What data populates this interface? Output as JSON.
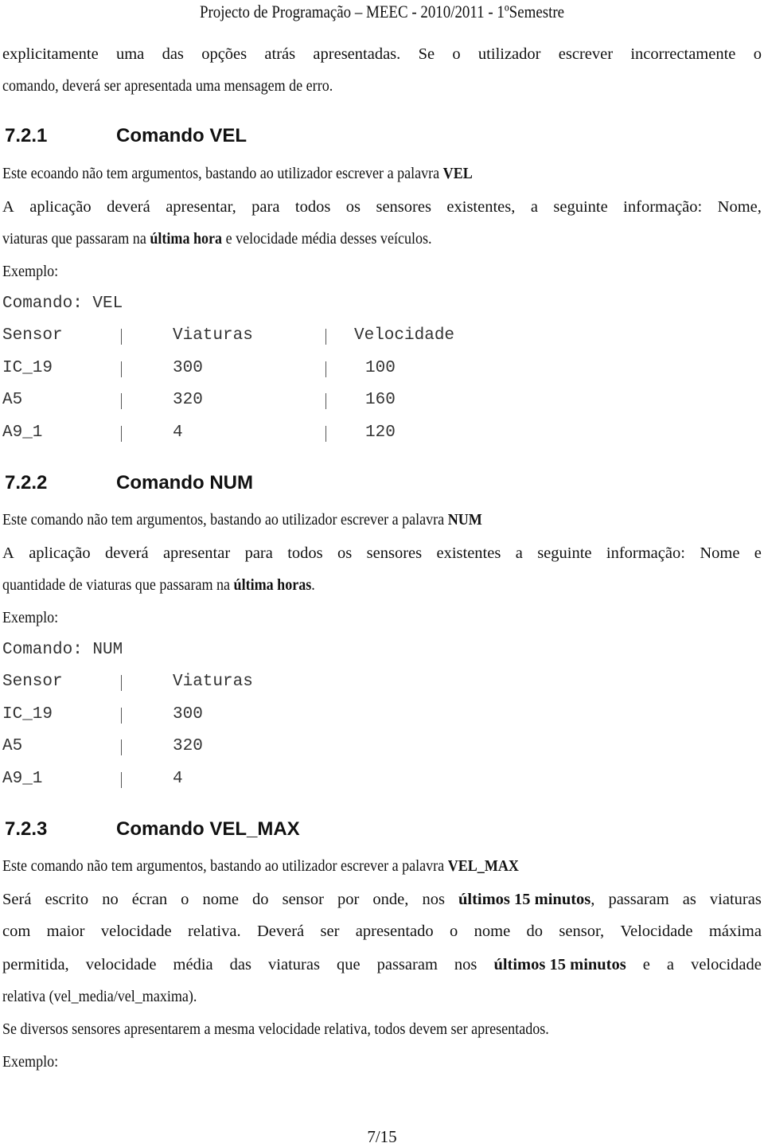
{
  "header": {
    "title": "Projecto de Programação – MEEC - 2010/2011 - 1ºSemestre"
  },
  "intro": {
    "line1": [
      "explicitamente",
      "uma",
      "das",
      "opções",
      "atrás",
      "apresentadas.",
      "Se",
      "o",
      "utilizador",
      "escrever",
      "incorrectamente",
      "o"
    ],
    "line2": "comando, deverá ser apresentada uma mensagem de erro."
  },
  "sections": [
    {
      "number": "7.2.1",
      "title": "Comando VEL",
      "desc_prefix": "Este ecoando não tem argumentos, bastando ao utilizador escrever a palavra ",
      "desc_keyword": "VEL",
      "info_line1": [
        "A",
        "aplicação",
        "deverá",
        "apresentar,",
        "para",
        "todos",
        "os",
        "sensores",
        "existentes,",
        "a",
        "seguinte",
        "informação:",
        "Nome,"
      ],
      "info_line2_prefix": "viaturas que passaram na ",
      "info_line2_bold": "última hora",
      "info_line2_suffix": " e velocidade média desses veículos.",
      "example_label": "Exemplo:",
      "command_line": "Comando: VEL",
      "table": {
        "headers": [
          "Sensor",
          "Viaturas",
          "Velocidade"
        ],
        "rows": [
          [
            "IC_19",
            "300",
            "100"
          ],
          [
            "A5",
            "320",
            "160"
          ],
          [
            "A9_1",
            "4",
            "120"
          ]
        ]
      }
    },
    {
      "number": "7.2.2",
      "title": "Comando NUM",
      "desc_prefix": "Este comando não tem argumentos, bastando ao utilizador escrever a palavra ",
      "desc_keyword": "NUM",
      "info_line1": [
        "A",
        "aplicação",
        "deverá",
        "apresentar",
        "para",
        "todos",
        "os",
        "sensores",
        "existentes",
        "a",
        "seguinte",
        "informação:",
        "Nome",
        "e"
      ],
      "info_line2_prefix": "quantidade de viaturas que passaram na ",
      "info_line2_bold": "última horas",
      "info_line2_suffix": ".",
      "example_label": "Exemplo:",
      "command_line": "Comando: NUM",
      "table": {
        "headers": [
          "Sensor",
          "Viaturas"
        ],
        "rows": [
          [
            "IC_19",
            "300"
          ],
          [
            "A5",
            "320"
          ],
          [
            "A9_1",
            "4"
          ]
        ]
      }
    },
    {
      "number": "7.2.3",
      "title": "Comando VEL_MAX",
      "desc_prefix": "Este comando não tem argumentos, bastando ao utilizador escrever a palavra ",
      "desc_keyword": "VEL_MAX",
      "p1_line1": {
        "a": [
          "Será",
          "escrito",
          "no",
          "écran",
          "o",
          "nome",
          "do",
          "sensor",
          "por",
          "onde,",
          "nos"
        ],
        "bold": "últimos 15 minutos",
        "b": [
          ",",
          "passaram",
          "as",
          "viaturas"
        ]
      },
      "p1_line2": [
        "com",
        "maior",
        "velocidade",
        "relativa.",
        "Deverá",
        "ser",
        "apresentado",
        "o",
        "nome",
        "do",
        "sensor,",
        "Velocidade",
        "máxima"
      ],
      "p1_line3": {
        "a": [
          "permitida,",
          "velocidade",
          "média",
          "das",
          "viaturas",
          "que",
          "passaram",
          "nos"
        ],
        "bold": "últimos 15 minutos",
        "b": [
          "e",
          "a",
          "velocidade"
        ]
      },
      "p1_line4": "relativa (vel_media/vel_maxima).",
      "p2": "Se diversos sensores apresentarem a mesma velocidade relativa, todos devem ser apresentados.",
      "example_label": "Exemplo:"
    }
  ],
  "footer": {
    "page": "7/15"
  }
}
